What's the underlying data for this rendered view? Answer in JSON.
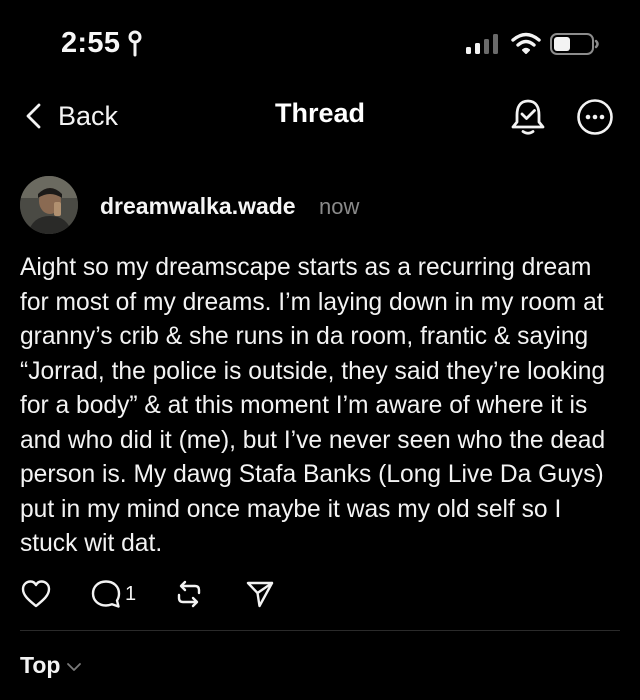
{
  "status_bar": {
    "time": "2:55",
    "icons": [
      "location-icon",
      "signal-icon",
      "wifi-icon",
      "battery-icon"
    ]
  },
  "nav": {
    "back_label": "Back",
    "title": "Thread",
    "icons": [
      "chevron-left-icon",
      "notification-bell-icon",
      "more-icon"
    ]
  },
  "post": {
    "username": "dreamwalka.wade",
    "timestamp": "now",
    "body": "Aight so my dreamscape starts as a recurring dream for most of my dreams. I’m laying down in my room at granny’s crib & she runs in da room, frantic & saying “Jorrad, the police is outside, they said they’re looking for a body” & at this moment I’m aware of where it is and who did it (me), but I’ve never seen who the dead person is. My dawg Stafa Banks (Long Live Da Guys) put in my mind once maybe it was my old self so I stuck wit dat.",
    "reply_count": "1",
    "action_icons": [
      "heart-icon",
      "comment-icon",
      "repost-icon",
      "send-icon"
    ]
  },
  "sort": {
    "label": "Top"
  },
  "colors": {
    "background": "#000000",
    "text": "#f3f3f3",
    "muted": "#8a8a8a",
    "divider": "#2a2a2a"
  }
}
